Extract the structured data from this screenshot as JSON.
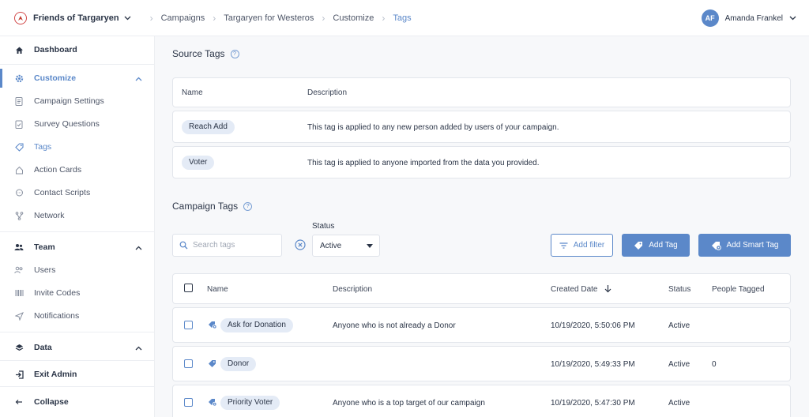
{
  "topbar": {
    "org_name": "Friends of Targaryen",
    "breadcrumbs": [
      "Campaigns",
      "Targaryen for Westeros",
      "Customize",
      "Tags"
    ],
    "user_initials": "AF",
    "user_name": "Amanda Frankel"
  },
  "sidebar": {
    "dashboard": "Dashboard",
    "customize": "Customize",
    "customize_items": [
      "Campaign Settings",
      "Survey Questions",
      "Tags",
      "Action Cards",
      "Contact Scripts",
      "Network"
    ],
    "team": "Team",
    "team_items": [
      "Users",
      "Invite Codes",
      "Notifications"
    ],
    "data": "Data",
    "exit_admin": "Exit Admin",
    "collapse": "Collapse"
  },
  "source_tags": {
    "title": "Source Tags",
    "headers": {
      "name": "Name",
      "description": "Description"
    },
    "rows": [
      {
        "name": "Reach Add",
        "description": "This tag is applied to any new person added by users of your campaign."
      },
      {
        "name": "Voter",
        "description": "This tag is applied to anyone imported from the data you provided."
      }
    ]
  },
  "campaign_tags": {
    "title": "Campaign Tags",
    "search_placeholder": "Search tags",
    "status_label": "Status",
    "status_value": "Active",
    "add_filter": "Add filter",
    "add_tag": "Add Tag",
    "add_smart_tag": "Add Smart Tag",
    "headers": {
      "name": "Name",
      "description": "Description",
      "created": "Created Date",
      "status": "Status",
      "people": "People Tagged"
    },
    "rows": [
      {
        "name": "Ask for Donation",
        "smart": true,
        "description": "Anyone who is not already a Donor",
        "created": "10/19/2020, 5:50:06 PM",
        "status": "Active",
        "people": ""
      },
      {
        "name": "Donor",
        "smart": false,
        "description": "",
        "created": "10/19/2020, 5:49:33 PM",
        "status": "Active",
        "people": "0"
      },
      {
        "name": "Priority Voter",
        "smart": true,
        "description": "Anyone who is a top target of our campaign",
        "created": "10/19/2020, 5:47:30 PM",
        "status": "Active",
        "people": ""
      }
    ]
  },
  "colors": {
    "accent": "#5b88c9",
    "pill": "#e4ebf6",
    "text": "#2b3547"
  }
}
